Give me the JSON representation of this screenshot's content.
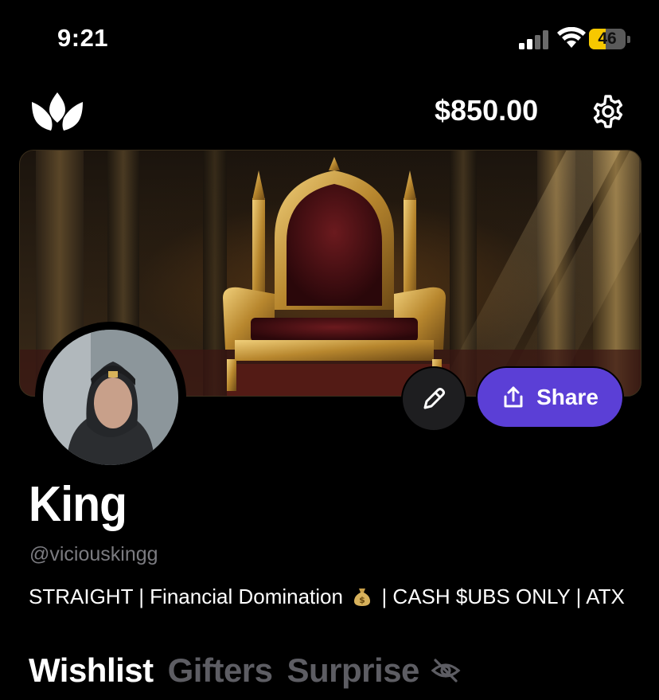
{
  "status_bar": {
    "time": "9:21",
    "battery_percent": "46",
    "battery_level": 0.46
  },
  "header": {
    "balance": "$850.00"
  },
  "banner": {
    "image": "golden-throne"
  },
  "profile": {
    "name": "King",
    "handle": "@viciouskingg",
    "bio_part1": "STRAIGHT | Financial Domination",
    "bio_part2": "| CASH $UBS ONLY | ATX"
  },
  "actions": {
    "share_label": "Share"
  },
  "tabs": [
    {
      "label": "Wishlist",
      "active": true
    },
    {
      "label": "Gifters",
      "active": false
    },
    {
      "label": "Surprise",
      "active": false
    }
  ],
  "colors": {
    "accent": "#5b3fd6",
    "battery": "#f7c800",
    "muted": "#7b7b80"
  }
}
